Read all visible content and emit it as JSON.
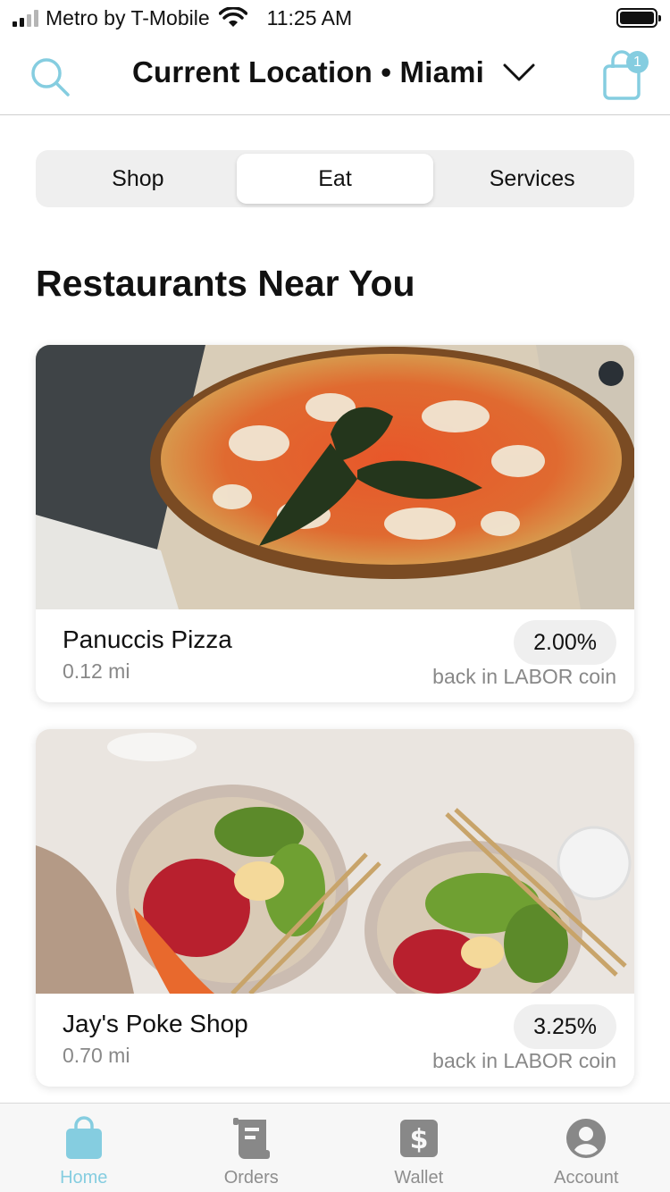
{
  "status_bar": {
    "carrier": "Metro by T-Mobile",
    "time": "11:25 AM"
  },
  "header": {
    "location_label": "Current Location • Miami",
    "cart_count": "1",
    "accent_color": "#85cde0"
  },
  "segments": [
    {
      "label": "Shop",
      "active": false
    },
    {
      "label": "Eat",
      "active": true
    },
    {
      "label": "Services",
      "active": false
    }
  ],
  "section_title": "Restaurants Near You",
  "restaurants": [
    {
      "name": "Panuccis Pizza",
      "distance": "0.12 mi",
      "percent": "2.00%",
      "reward_text": "back in LABOR coin",
      "image": "pizza-photo"
    },
    {
      "name": "Jay's Poke Shop",
      "distance": "0.70 mi",
      "percent": "3.25%",
      "reward_text": "back in LABOR coin",
      "image": "poke-bowl-photo"
    }
  ],
  "tab_bar": {
    "items": [
      {
        "label": "Home",
        "icon": "shopping-bag-icon",
        "active": true
      },
      {
        "label": "Orders",
        "icon": "receipt-icon",
        "active": false
      },
      {
        "label": "Wallet",
        "icon": "dollar-icon",
        "active": false
      },
      {
        "label": "Account",
        "icon": "user-icon",
        "active": false
      }
    ]
  }
}
